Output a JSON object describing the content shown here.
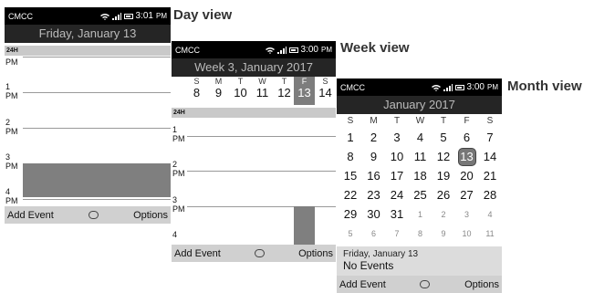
{
  "captions": {
    "day": "Day view",
    "week": "Week view",
    "month": "Month view"
  },
  "day": {
    "status": {
      "carrier": "CMCC",
      "time": "3:01",
      "ampm": "PM"
    },
    "title": "Friday, January 13",
    "band": "24H",
    "hours": [
      {
        "pm": "PM",
        "num": ""
      },
      {
        "pm": "PM",
        "num": "1"
      },
      {
        "pm": "PM",
        "num": "2"
      },
      {
        "pm": "PM",
        "num": "3"
      },
      {
        "pm": "PM",
        "num": "4"
      }
    ],
    "softkeys": {
      "left": "Add Event",
      "right": "Options"
    }
  },
  "week": {
    "status": {
      "carrier": "CMCC",
      "time": "3:00",
      "ampm": "PM"
    },
    "title": "Week 3, January 2017",
    "days": [
      {
        "letter": "S",
        "num": "8"
      },
      {
        "letter": "M",
        "num": "9"
      },
      {
        "letter": "T",
        "num": "10"
      },
      {
        "letter": "W",
        "num": "11"
      },
      {
        "letter": "T",
        "num": "12"
      },
      {
        "letter": "F",
        "num": "13",
        "selected": true
      },
      {
        "letter": "S",
        "num": "14"
      }
    ],
    "band": "24H",
    "hours": [
      "1",
      "2",
      "3",
      "4"
    ],
    "pm": "PM",
    "softkeys": {
      "left": "Add Event",
      "right": "Options"
    }
  },
  "month": {
    "status": {
      "carrier": "CMCC",
      "time": "3:00",
      "ampm": "PM"
    },
    "title": "January 2017",
    "dow": [
      "S",
      "M",
      "T",
      "W",
      "T",
      "F",
      "S"
    ],
    "weeks": [
      [
        "1",
        "2",
        "3",
        "4",
        "5",
        "6",
        "7"
      ],
      [
        "8",
        "9",
        "10",
        "11",
        "12",
        "13",
        "14"
      ],
      [
        "15",
        "16",
        "17",
        "18",
        "19",
        "20",
        "21"
      ],
      [
        "22",
        "23",
        "24",
        "25",
        "26",
        "27",
        "28"
      ],
      [
        "29",
        "30",
        "31",
        "1",
        "2",
        "3",
        "4"
      ],
      [
        "5",
        "6",
        "7",
        "8",
        "9",
        "10",
        "11"
      ]
    ],
    "selected": "13",
    "agenda": {
      "date": "Friday, January 13",
      "events": "No Events"
    },
    "softkeys": {
      "left": "Add Event",
      "right": "Options"
    }
  },
  "colors": {
    "status_bg": "#000000",
    "title_bg": "#252525",
    "softkey_bg": "#d0d0d0",
    "event_block": "#7f7f7f"
  }
}
